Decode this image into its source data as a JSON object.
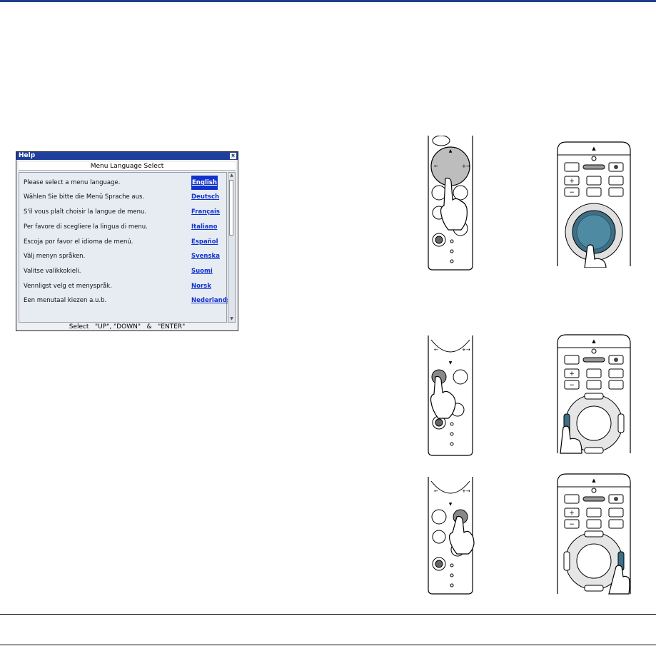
{
  "help_dialog": {
    "title": "Help",
    "close_glyph": "×",
    "header": "Menu Language Select",
    "rows": [
      {
        "sentence": "Please select a menu language.",
        "language": "English",
        "selected": true
      },
      {
        "sentence": "Wählen Sie bitte die Menü Sprache aus.",
        "language": "Deutsch",
        "selected": false
      },
      {
        "sentence": "S'il vous plaît choisir la langue de menu.",
        "language": "Français",
        "selected": false
      },
      {
        "sentence": "Per favore di scegliere la lingua di menu.",
        "language": "Italiano",
        "selected": false
      },
      {
        "sentence": "Escoja por favor el idioma de menú.",
        "language": "Español",
        "selected": false
      },
      {
        "sentence": "Välj menyn språken.",
        "language": "Svenska",
        "selected": false
      },
      {
        "sentence": "Valitse valikkokieli.",
        "language": "Suomi",
        "selected": false
      },
      {
        "sentence": "Vennligst velg et menyspråk.",
        "language": "Norsk",
        "selected": false
      },
      {
        "sentence": "Een menutaal kiezen a.u.b.",
        "language": "Nederlands",
        "selected": false
      }
    ],
    "footer": "Select   \"UP\", \"DOWN\"   &   \"ENTER\""
  },
  "icons": {
    "remote_navigate": "remote-control-select-pad-icon",
    "projector_navigate": "projector-panel-select-pad-icon",
    "remote_enter": "remote-control-enter-button-icon",
    "projector_enter": "projector-panel-enter-button-icon",
    "remote_exit": "remote-control-exit-button-icon",
    "projector_exit": "projector-panel-exit-button-icon"
  },
  "colors": {
    "title_bar": "#1f3f9c",
    "link": "#1133cc",
    "pressed_button": "#3d6f86",
    "rule": "#1f3c8a"
  }
}
